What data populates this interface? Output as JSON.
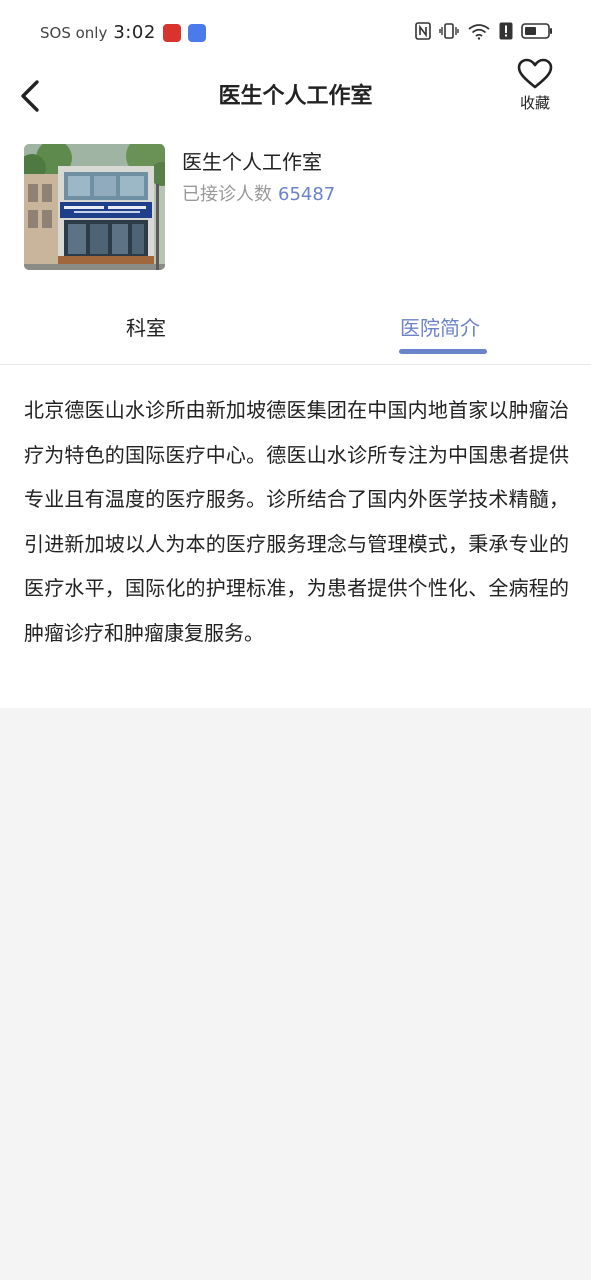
{
  "status_bar": {
    "carrier": "SOS only",
    "time": "3:02",
    "icons": [
      "nfc-icon",
      "vibrate-icon",
      "wifi-icon",
      "alert-icon",
      "battery-icon"
    ]
  },
  "header": {
    "title": "医生个人工作室",
    "favorite_label": "收藏"
  },
  "hospital": {
    "name": "医生个人工作室",
    "visits_label": "已接诊人数",
    "visits_count": "65487"
  },
  "tabs": [
    {
      "label": "科室",
      "active": false
    },
    {
      "label": "医院简介",
      "active": true
    }
  ],
  "introduction": {
    "text": "北京德医山水诊所由新加坡德医集团在中国内地首家以肿瘤治疗为特色的国际医疗中心。德医山水诊所专注为中国患者提供专业且有温度的医疗服务。诊所结合了国内外医学技术精髓，引进新加坡以人为本的医疗服务理念与管理模式，秉承专业的医疗水平，国际化的护理标准，为患者提供个性化、全病程的肿瘤诊疗和肿瘤康复服务。"
  },
  "colors": {
    "accent": "#6b83c8",
    "text": "#222222",
    "muted": "#999999",
    "page_bg": "#f4f4f4"
  }
}
